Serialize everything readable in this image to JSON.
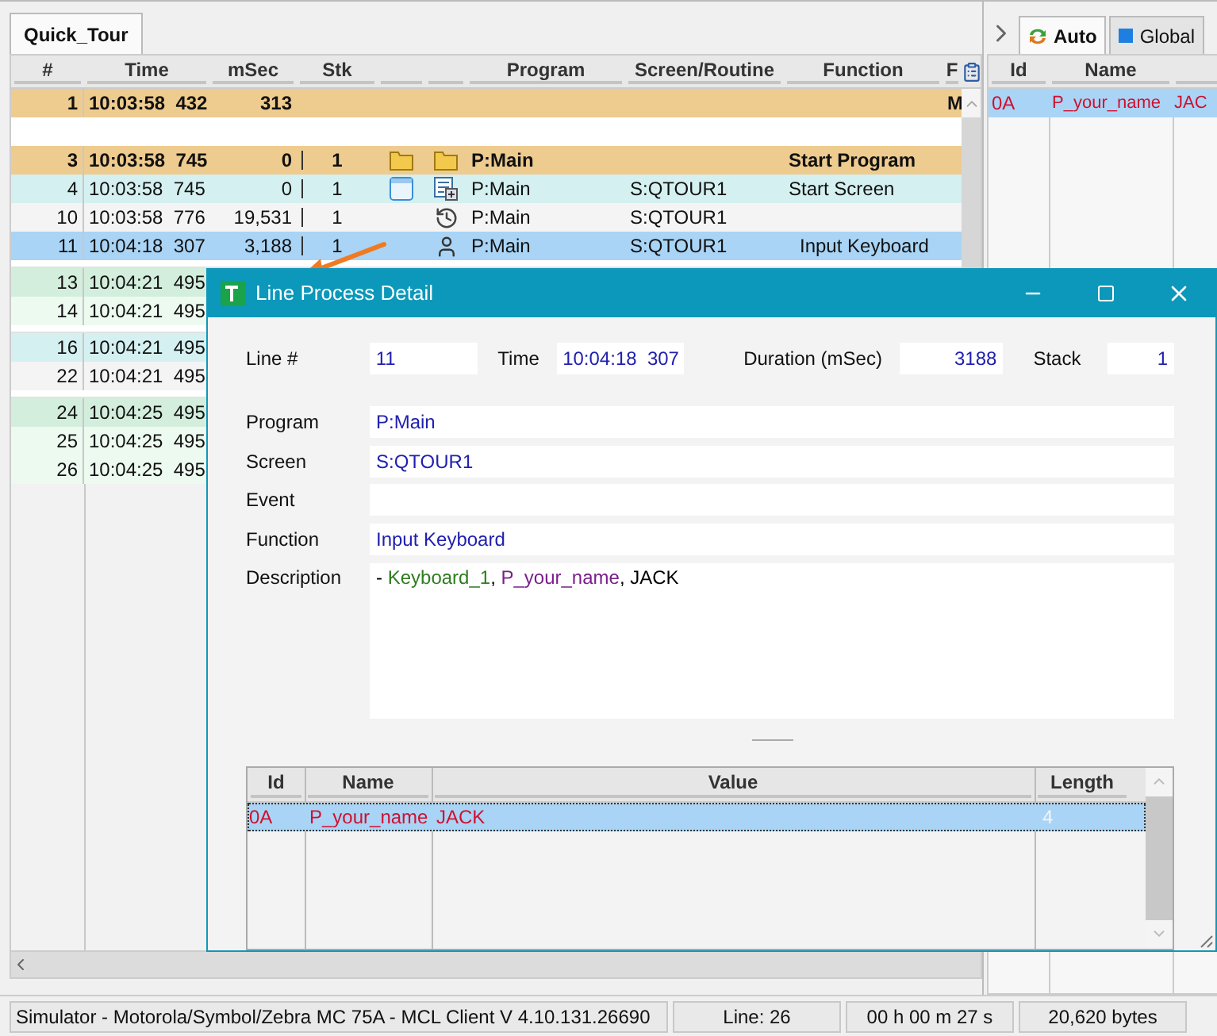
{
  "left_tab": {
    "label": "Quick_Tour",
    "selected": true
  },
  "log_table": {
    "columns": [
      "#",
      "Time",
      "mSec",
      "Stk",
      "Program",
      "Screen/Routine",
      "Function",
      "F"
    ],
    "rows": [
      {
        "kind": "plain",
        "num": "1",
        "time": "10:03:58  432",
        "msec": "313",
        "f": "M",
        "color": "#eecb8e",
        "bold": true,
        "selected": false
      },
      {
        "kind": "blank",
        "color": "#ffffff"
      },
      {
        "kind": "program_start",
        "num": "3",
        "time": "10:03:58  745",
        "msec": "0",
        "stk": "1",
        "program": "P:Main",
        "function": "Start Program",
        "color": "#eecb8e",
        "bold": true,
        "selected": false
      },
      {
        "kind": "screen_start",
        "num": "4",
        "time": "10:03:58  745",
        "msec": "0",
        "stk": "1",
        "program": "P:Main",
        "screen": "S:QTOUR1",
        "function": "Start Screen",
        "color": "#d5f0f0",
        "bold": false,
        "selected": false
      },
      {
        "kind": "history",
        "num": "10",
        "time": "10:03:58  776",
        "msec": "19,531",
        "stk": "1",
        "program": "P:Main",
        "screen": "S:QTOUR1",
        "color": "#f4f4f4",
        "bold": false,
        "selected": false
      },
      {
        "kind": "input",
        "num": "11",
        "time": "10:04:18  307",
        "msec": "3,188",
        "stk": "1",
        "program": "P:Main",
        "screen": "S:QTOUR1",
        "function": "Input Keyboard",
        "bold": false,
        "selected": true
      },
      {
        "kind": "plain",
        "num": "13",
        "time": "10:04:21  495",
        "color": "#d3eedc",
        "bold": false,
        "selected": false,
        "gap_before": true
      },
      {
        "kind": "plain",
        "num": "14",
        "time": "10:04:21  495",
        "color": "#edfaf0",
        "bold": false,
        "selected": false
      },
      {
        "kind": "plain",
        "num": "16",
        "time": "10:04:21  495",
        "color": "#d5f0f0",
        "bold": false,
        "selected": false,
        "gap_before": true
      },
      {
        "kind": "plain",
        "num": "22",
        "time": "10:04:21  495",
        "color": "#f4f4f4",
        "bold": false,
        "selected": false
      },
      {
        "kind": "plain",
        "num": "24",
        "time": "10:04:25  495",
        "color": "#d3eedc",
        "bold": false,
        "selected": false,
        "gap_before": true
      },
      {
        "kind": "plain",
        "num": "25",
        "time": "10:04:25  495",
        "color": "#edfaf0",
        "bold": false,
        "selected": false
      },
      {
        "kind": "plain",
        "num": "26",
        "time": "10:04:25  495",
        "color": "#edfaf0",
        "bold": false,
        "selected": false
      }
    ]
  },
  "right_panel": {
    "tabs": [
      {
        "kind": "auto",
        "label": "Auto",
        "selected": true
      },
      {
        "kind": "global",
        "label": "Global",
        "selected": false
      }
    ],
    "columns": [
      "Id",
      "Name"
    ],
    "rows": [
      {
        "id": "0A",
        "name": "P_your_name",
        "value": "JAC",
        "selected": true
      }
    ]
  },
  "dialog": {
    "title": "Line Process Detail",
    "line": {
      "label": "Line #",
      "value": "11"
    },
    "time": {
      "label": "Time",
      "value": "10:04:18  307"
    },
    "duration": {
      "label": "Duration (mSec)",
      "value": "3188"
    },
    "stack": {
      "label": "Stack",
      "value": "1"
    },
    "fields": [
      {
        "label": "Program",
        "value": "P:Main"
      },
      {
        "label": "Screen",
        "value": "S:QTOUR1"
      },
      {
        "label": "Event"
      },
      {
        "label": "Function",
        "value": "Input Keyboard"
      }
    ],
    "description": {
      "label": "Description",
      "parts": [
        {
          "text": "- ",
          "color": "#000000"
        },
        {
          "text": "Keyboard_1",
          "color": "#2f7d1f"
        },
        {
          "text": ", ",
          "color": "#000000"
        },
        {
          "text": "P_your_name",
          "color": "#7a1f8a"
        },
        {
          "text": ", JACK",
          "color": "#000000"
        }
      ]
    },
    "grid": {
      "columns": [
        "Id",
        "Name",
        "Value",
        "Length"
      ],
      "rows": [
        {
          "id": "0A",
          "name": "P_your_name",
          "value": "JACK",
          "length": "4",
          "selected": true
        }
      ]
    }
  },
  "status_bar": [
    "Simulator - Motorola/Symbol/Zebra MC 75A - MCL Client V 4.10.131.26690",
    "Line: 26",
    "00 h 00 m 27 s",
    "20,620 bytes"
  ]
}
